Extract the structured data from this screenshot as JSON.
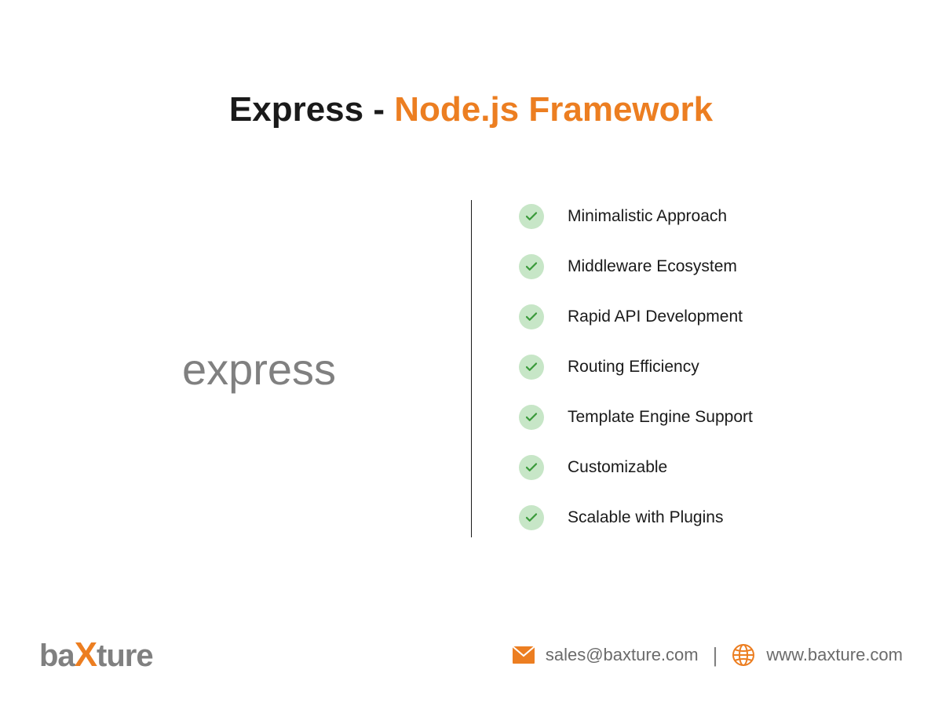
{
  "title": {
    "prefix": "Express - ",
    "highlight": "Node.js Framework"
  },
  "logo": {
    "text": "express"
  },
  "features": [
    "Minimalistic Approach",
    "Middleware Ecosystem",
    "Rapid API Development",
    "Routing Efficiency",
    "Template Engine Support",
    "Customizable",
    "Scalable with Plugins"
  ],
  "footer": {
    "company": {
      "part1": "ba",
      "x": "X",
      "part2": "ture"
    },
    "email": "sales@baxture.com",
    "website": "www.baxture.com",
    "separator": "|"
  },
  "colors": {
    "accent": "#ec7e21",
    "check_bg": "#c7e6c7",
    "check_stroke": "#3a9a3a"
  }
}
